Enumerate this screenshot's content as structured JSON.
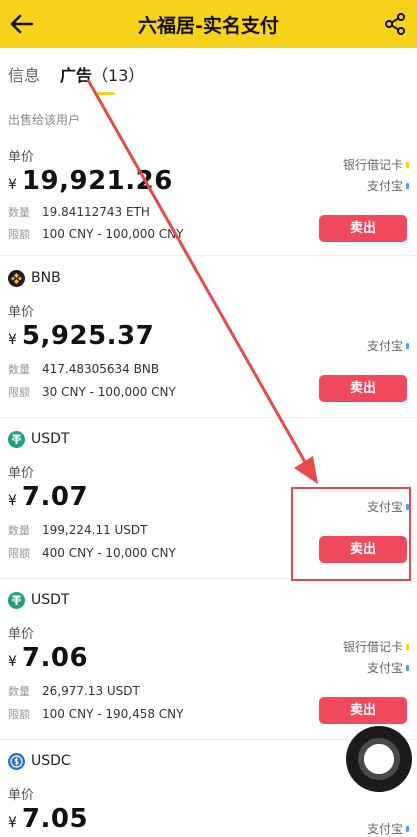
{
  "header": {
    "title": "六福居-实名支付",
    "back_icon": "back-arrow-icon",
    "share_icon": "share-icon"
  },
  "tabs": [
    {
      "label": "信息"
    },
    {
      "label": "广告",
      "count": "（13）"
    }
  ],
  "section_label": "出售给该用户",
  "labels": {
    "unit_price": "单价",
    "quantity": "数量",
    "limit": "限额",
    "yen": "¥",
    "sell": "卖出"
  },
  "cards": [
    {
      "coin": "",
      "price": "19,921.26",
      "quantity": "19.84112743 ETH",
      "limit": "100 CNY - 100,000 CNY",
      "payments": [
        "银行借记卡",
        "支付宝"
      ]
    },
    {
      "coin": "BNB",
      "price": "5,925.37",
      "quantity": "417.48305634 BNB",
      "limit": "30 CNY - 100,000 CNY",
      "payments": [
        "支付宝"
      ]
    },
    {
      "coin": "USDT",
      "price": "7.07",
      "quantity": "199,224.11 USDT",
      "limit": "400 CNY - 10,000 CNY",
      "payments": [
        "支付宝"
      ]
    },
    {
      "coin": "USDT",
      "price": "7.06",
      "quantity": "26,977.13 USDT",
      "limit": "100 CNY - 190,458 CNY",
      "payments": [
        "银行借记卡",
        "支付宝"
      ]
    },
    {
      "coin": "USDC",
      "price": "7.05",
      "payments": [
        "支付宝"
      ]
    }
  ],
  "colors": {
    "header": "#f7d21a",
    "sell_button": "#f0495c",
    "annotation": "#e84a4a",
    "bank_dot": "#f7d21a",
    "alipay_dot": "#4aa3f0"
  }
}
